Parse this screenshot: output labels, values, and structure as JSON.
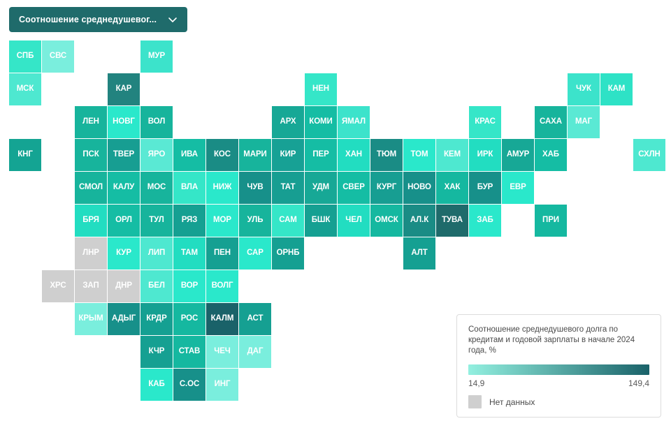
{
  "selector": {
    "label": "Соотношение среднедушевог...",
    "icon": "chevron-down-icon",
    "background": "#1f6b6b"
  },
  "legend": {
    "title": "Соотношение среднедушевого долга по кредитам и годовой зарплаты в начале 2024 года, %",
    "min_label": "14,9",
    "max_label": "149,4",
    "nodata_label": "Нет данных",
    "nodata_color": "#cfcfcf",
    "ramp_start": "#93f0e0",
    "ramp_end": "#1a6269"
  },
  "chart_data": {
    "type": "heatmap",
    "title": "Соотношение среднедушевого долга по кредитам и годовой зарплаты в начале 2024 года, %",
    "xlabel": "",
    "ylabel": "",
    "value_range": [
      14.9,
      149.4
    ],
    "colorscale": [
      "#93f0e0",
      "#1a6269"
    ],
    "nodata_color": "#cfcfcf",
    "grid": false,
    "legend_position": "bottom-right",
    "cell_size": 46,
    "cell_pitch": 47,
    "tiles": [
      {
        "label": "СПБ",
        "col": 0,
        "row": 0,
        "color": "#35e6c8"
      },
      {
        "label": "СВС",
        "col": 1,
        "row": 0,
        "color": "#7aeedd"
      },
      {
        "label": "МУР",
        "col": 4,
        "row": 0,
        "color": "#3ce3cb"
      },
      {
        "label": "МСК",
        "col": 0,
        "row": 1,
        "color": "#4ee8d0"
      },
      {
        "label": "КАР",
        "col": 3,
        "row": 1,
        "color": "#22837f"
      },
      {
        "label": "НЕН",
        "col": 9,
        "row": 1,
        "color": "#35e6c8"
      },
      {
        "label": "ЧУК",
        "col": 17,
        "row": 1,
        "color": "#3ce3cb"
      },
      {
        "label": "КАМ",
        "col": 18,
        "row": 1,
        "color": "#2ee2c6"
      },
      {
        "label": "ЛЕН",
        "col": 2,
        "row": 2,
        "color": "#17b49c"
      },
      {
        "label": "НОВГ",
        "col": 3,
        "row": 2,
        "color": "#2ae8cb"
      },
      {
        "label": "ВОЛ",
        "col": 4,
        "row": 2,
        "color": "#17b49c"
      },
      {
        "label": "АРХ",
        "col": 8,
        "row": 2,
        "color": "#17a896"
      },
      {
        "label": "КОМИ",
        "col": 9,
        "row": 2,
        "color": "#15bda4"
      },
      {
        "label": "ЯМАЛ",
        "col": 10,
        "row": 2,
        "color": "#3ce3cb"
      },
      {
        "label": "КРАС",
        "col": 14,
        "row": 2,
        "color": "#35e6c8"
      },
      {
        "label": "САХА",
        "col": 16,
        "row": 2,
        "color": "#17b49c"
      },
      {
        "label": "МАГ",
        "col": 17,
        "row": 2,
        "color": "#5ae9d4"
      },
      {
        "label": "КНГ",
        "col": 0,
        "row": 3,
        "color": "#14a493"
      },
      {
        "label": "ПСК",
        "col": 2,
        "row": 3,
        "color": "#17b49c"
      },
      {
        "label": "ТВЕР",
        "col": 3,
        "row": 3,
        "color": "#179e92"
      },
      {
        "label": "ЯРО",
        "col": 4,
        "row": 3,
        "color": "#5ae9d4"
      },
      {
        "label": "ИВА",
        "col": 5,
        "row": 3,
        "color": "#15bda4"
      },
      {
        "label": "КОС",
        "col": 6,
        "row": 3,
        "color": "#1a8c85"
      },
      {
        "label": "МАРИ",
        "col": 7,
        "row": 3,
        "color": "#17b49c"
      },
      {
        "label": "КИР",
        "col": 8,
        "row": 3,
        "color": "#17a195"
      },
      {
        "label": "ПЕР",
        "col": 9,
        "row": 3,
        "color": "#15bda4"
      },
      {
        "label": "ХАН",
        "col": 10,
        "row": 3,
        "color": "#22ddc1"
      },
      {
        "label": "ТЮМ",
        "col": 11,
        "row": 3,
        "color": "#1a8c85"
      },
      {
        "label": "ТОМ",
        "col": 12,
        "row": 3,
        "color": "#2ae8cb"
      },
      {
        "label": "КЕМ",
        "col": 13,
        "row": 3,
        "color": "#4ee8d0"
      },
      {
        "label": "ИРК",
        "col": 14,
        "row": 3,
        "color": "#22ddc1"
      },
      {
        "label": "АМУР",
        "col": 15,
        "row": 3,
        "color": "#17a896"
      },
      {
        "label": "ХАБ",
        "col": 16,
        "row": 3,
        "color": "#15bda4"
      },
      {
        "label": "СХЛН",
        "col": 19,
        "row": 3,
        "color": "#4ee8d0"
      },
      {
        "label": "СМОЛ",
        "col": 2,
        "row": 4,
        "color": "#17b49c"
      },
      {
        "label": "КАЛУ",
        "col": 3,
        "row": 4,
        "color": "#15bda4"
      },
      {
        "label": "МОС",
        "col": 4,
        "row": 4,
        "color": "#17b49c"
      },
      {
        "label": "ВЛА",
        "col": 5,
        "row": 4,
        "color": "#35e6c8"
      },
      {
        "label": "НИЖ",
        "col": 6,
        "row": 4,
        "color": "#2ae8cb"
      },
      {
        "label": "ЧУВ",
        "col": 7,
        "row": 4,
        "color": "#17908a"
      },
      {
        "label": "ТАТ",
        "col": 8,
        "row": 4,
        "color": "#179e92"
      },
      {
        "label": "УДМ",
        "col": 9,
        "row": 4,
        "color": "#17a896"
      },
      {
        "label": "СВЕР",
        "col": 10,
        "row": 4,
        "color": "#15bda4"
      },
      {
        "label": "КУРГ",
        "col": 11,
        "row": 4,
        "color": "#179e92"
      },
      {
        "label": "НОВО",
        "col": 12,
        "row": 4,
        "color": "#17908a"
      },
      {
        "label": "ХАК",
        "col": 13,
        "row": 4,
        "color": "#15b8a0"
      },
      {
        "label": "БУР",
        "col": 14,
        "row": 4,
        "color": "#17908a"
      },
      {
        "label": "ЕВР",
        "col": 15,
        "row": 4,
        "color": "#2ae8cb"
      },
      {
        "label": "БРЯ",
        "col": 2,
        "row": 5,
        "color": "#22ddc1"
      },
      {
        "label": "ОРЛ",
        "col": 3,
        "row": 5,
        "color": "#15bda4"
      },
      {
        "label": "ТУЛ",
        "col": 4,
        "row": 5,
        "color": "#17b49c"
      },
      {
        "label": "РЯЗ",
        "col": 5,
        "row": 5,
        "color": "#15a092"
      },
      {
        "label": "МОР",
        "col": 6,
        "row": 5,
        "color": "#2ae8cb"
      },
      {
        "label": "УЛЬ",
        "col": 7,
        "row": 5,
        "color": "#17b49c"
      },
      {
        "label": "САМ",
        "col": 8,
        "row": 5,
        "color": "#35e6c8"
      },
      {
        "label": "БШК",
        "col": 9,
        "row": 5,
        "color": "#15a092"
      },
      {
        "label": "ЧЕЛ",
        "col": 10,
        "row": 5,
        "color": "#22ddc1"
      },
      {
        "label": "ОМСК",
        "col": 11,
        "row": 5,
        "color": "#15b8a0"
      },
      {
        "label": "АЛ.К",
        "col": 12,
        "row": 5,
        "color": "#1a8c85"
      },
      {
        "label": "ТУВА",
        "col": 13,
        "row": 5,
        "color": "#1f6b6b"
      },
      {
        "label": "ЗАБ",
        "col": 14,
        "row": 5,
        "color": "#2ae8cb"
      },
      {
        "label": "ПРИ",
        "col": 16,
        "row": 5,
        "color": "#15b8a0"
      },
      {
        "label": "ЛНР",
        "col": 2,
        "row": 6,
        "color": "#cfcfcf",
        "nodata": true
      },
      {
        "label": "КУР",
        "col": 3,
        "row": 6,
        "color": "#2ae8cb"
      },
      {
        "label": "ЛИП",
        "col": 4,
        "row": 6,
        "color": "#4ee8d0"
      },
      {
        "label": "ТАМ",
        "col": 5,
        "row": 6,
        "color": "#22ddc1"
      },
      {
        "label": "ПЕН",
        "col": 6,
        "row": 6,
        "color": "#15a092"
      },
      {
        "label": "САР",
        "col": 7,
        "row": 6,
        "color": "#2ae8cb"
      },
      {
        "label": "ОРНБ",
        "col": 8,
        "row": 6,
        "color": "#15a092"
      },
      {
        "label": "АЛТ",
        "col": 12,
        "row": 6,
        "color": "#15a092"
      },
      {
        "label": "ХРС",
        "col": 1,
        "row": 7,
        "color": "#cfcfcf",
        "nodata": true
      },
      {
        "label": "ЗАП",
        "col": 2,
        "row": 7,
        "color": "#cfcfcf",
        "nodata": true
      },
      {
        "label": "ДНР",
        "col": 3,
        "row": 7,
        "color": "#cfcfcf",
        "nodata": true
      },
      {
        "label": "БЕЛ",
        "col": 4,
        "row": 7,
        "color": "#4ee8d0"
      },
      {
        "label": "ВОР",
        "col": 5,
        "row": 7,
        "color": "#2ae8cb"
      },
      {
        "label": "ВОЛГ",
        "col": 6,
        "row": 7,
        "color": "#2ae8cb"
      },
      {
        "label": "КРЫМ",
        "col": 2,
        "row": 8,
        "color": "#7aeedd"
      },
      {
        "label": "АДЫГ",
        "col": 3,
        "row": 8,
        "color": "#17908a"
      },
      {
        "label": "КРДР",
        "col": 4,
        "row": 8,
        "color": "#15a092"
      },
      {
        "label": "РОС",
        "col": 5,
        "row": 8,
        "color": "#15b8a0"
      },
      {
        "label": "КАЛМ",
        "col": 6,
        "row": 8,
        "color": "#1a6269"
      },
      {
        "label": "АСТ",
        "col": 7,
        "row": 8,
        "color": "#15a092"
      },
      {
        "label": "КЧР",
        "col": 4,
        "row": 9,
        "color": "#15a092"
      },
      {
        "label": "СТАВ",
        "col": 5,
        "row": 9,
        "color": "#15b8a0"
      },
      {
        "label": "ЧЕЧ",
        "col": 6,
        "row": 9,
        "color": "#7aeedd"
      },
      {
        "label": "ДАГ",
        "col": 7,
        "row": 9,
        "color": "#7aeedd"
      },
      {
        "label": "КАБ",
        "col": 4,
        "row": 10,
        "color": "#2ae8cb"
      },
      {
        "label": "С.ОС",
        "col": 5,
        "row": 10,
        "color": "#17908a"
      },
      {
        "label": "ИНГ",
        "col": 6,
        "row": 10,
        "color": "#7aeedd"
      }
    ]
  }
}
